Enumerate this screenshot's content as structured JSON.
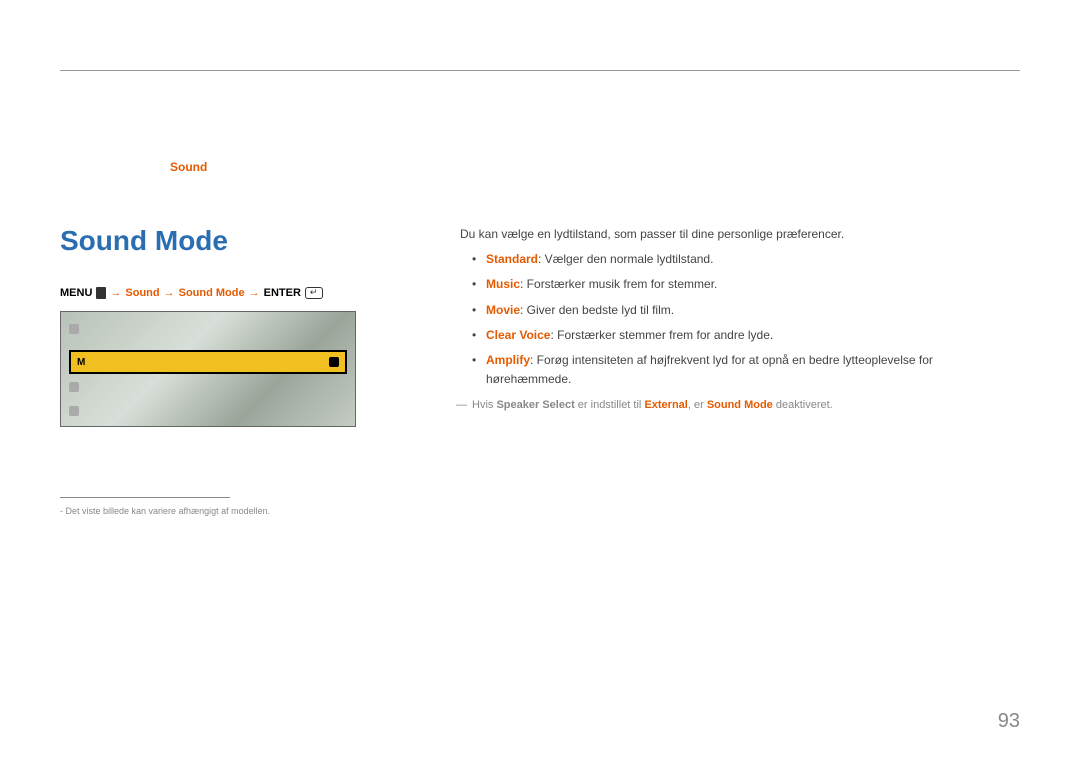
{
  "chapter": {
    "label": "Sound"
  },
  "section": {
    "title": "Sound Mode"
  },
  "menu_path": {
    "menu_label": "MENU",
    "arrow": "→",
    "step1": "Sound",
    "step2": "Sound Mode",
    "enter_label": "ENTER"
  },
  "screenshot": {
    "highlight_left": "M",
    "highlight_right_icon": "hand-icon"
  },
  "footnote": {
    "text": "Det viste billede kan variere afhængigt af modellen."
  },
  "body": {
    "intro": "Du kan vælge en lydtilstand, som passer til dine personlige præferencer.",
    "items": [
      {
        "label": "Standard",
        "desc": ": Vælger den normale lydtilstand."
      },
      {
        "label": "Music",
        "desc": ": Forstærker musik frem for stemmer."
      },
      {
        "label": "Movie",
        "desc": ": Giver den bedste lyd til film."
      },
      {
        "label": "Clear Voice",
        "desc": ": Forstærker stemmer frem for andre lyde."
      },
      {
        "label": "Amplify",
        "desc": ": Forøg intensiteten af højfrekvent lyd for at opnå en bedre lytteoplevelse for hørehæmmede."
      }
    ],
    "note": {
      "pre": "Hvis ",
      "b1": "Speaker Select",
      "mid1": " er indstillet til ",
      "o1": "External",
      "mid2": ", er ",
      "o2": "Sound Mode",
      "post": " deaktiveret."
    }
  },
  "page_number": "93"
}
